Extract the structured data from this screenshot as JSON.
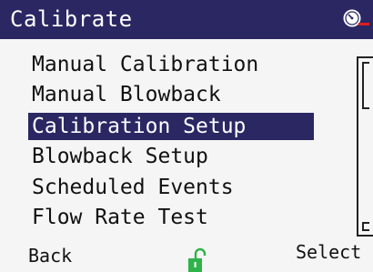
{
  "header": {
    "title": "Calibrate",
    "status_icon": "gauge-alarm-icon"
  },
  "menu": {
    "items": [
      {
        "label": "Manual Calibration",
        "selected": false
      },
      {
        "label": "Manual Blowback",
        "selected": false
      },
      {
        "label": "Calibration Setup",
        "selected": true
      },
      {
        "label": "Blowback Setup",
        "selected": false
      },
      {
        "label": "Scheduled Events",
        "selected": false
      },
      {
        "label": "Flow Rate Test",
        "selected": false
      }
    ]
  },
  "softkeys": {
    "left": "Back",
    "right": "Select",
    "center_icon": "unlocked-padlock-icon"
  },
  "colors": {
    "header_bg": "#2a2763",
    "selection_bg": "#2a2763",
    "lock_green": "#2fb34a",
    "alarm_red": "#e01e1e"
  }
}
